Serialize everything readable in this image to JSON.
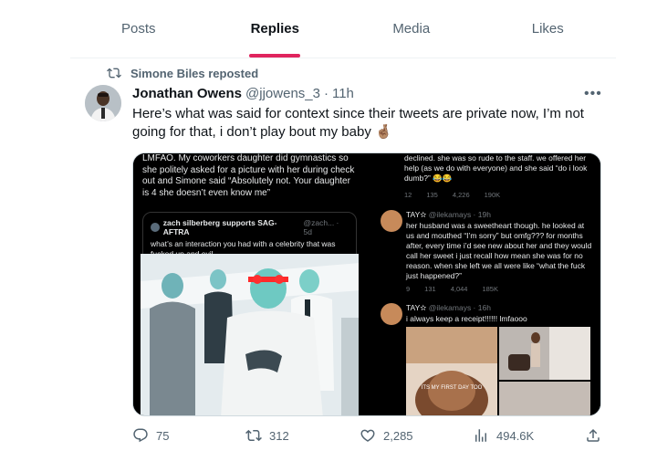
{
  "tabs": [
    {
      "label": "Posts",
      "active": false
    },
    {
      "label": "Replies",
      "active": true
    },
    {
      "label": "Media",
      "active": false
    },
    {
      "label": "Likes",
      "active": false
    }
  ],
  "repost": {
    "label": "Simone Biles reposted"
  },
  "post": {
    "author_name": "Jonathan Owens",
    "handle": "@jjowens_3",
    "separator": "·",
    "time": "11h",
    "text": "Here’s what was said for context since their tweets are private now, I’m not going for that, i don’t play bout my baby 🤞🏽",
    "more": "•••"
  },
  "media": {
    "left": {
      "tweet_text": "LMFAO. My coworkers daughter did gymnastics so she politely asked for a picture with her during check out and Simone said “Absolutely not. Your daughter is 4 she doesn’t even know me”",
      "quote_name": "zach silberberg supports SAG-AFTRA",
      "quote_meta": "@zach... · 5d",
      "quote_text": "what’s an interaction you had with a celebrity that was fucked up and evil"
    },
    "right": {
      "top_text": "declined. she was so rude to the staff. we offered her help (as we do with everyone) and she said “do i look dumb?” 😂😂",
      "top_stats": [
        "12",
        "135",
        "4,226",
        "190K"
      ],
      "reply1_name": "TAY✫",
      "reply1_handle": "@ilekamays · 19h",
      "reply1_text": "her husband was a sweetheart though. he looked at us and mouthed “I’m sorry” but omfg??? for months after, every time i’d see new about her and they would call her sweet i just recall how mean she was for no reason. when she left we all were like “what the fuck just happened?”",
      "reply1_stats": [
        "9",
        "131",
        "4,044",
        "185K"
      ],
      "reply2_name": "TAY✫",
      "reply2_handle": "@ilekamays · 16h",
      "reply2_text": "i always keep a receipt!!!!!! lmfaooo",
      "photo_caption": "ITS MY FIRST DAY TOO"
    }
  },
  "actions": {
    "replies": "75",
    "reposts": "312",
    "likes": "2,285",
    "views": "494.6K"
  },
  "colors": {
    "accent": "#e0245e",
    "text": "#0f1419",
    "muted": "#536471"
  }
}
